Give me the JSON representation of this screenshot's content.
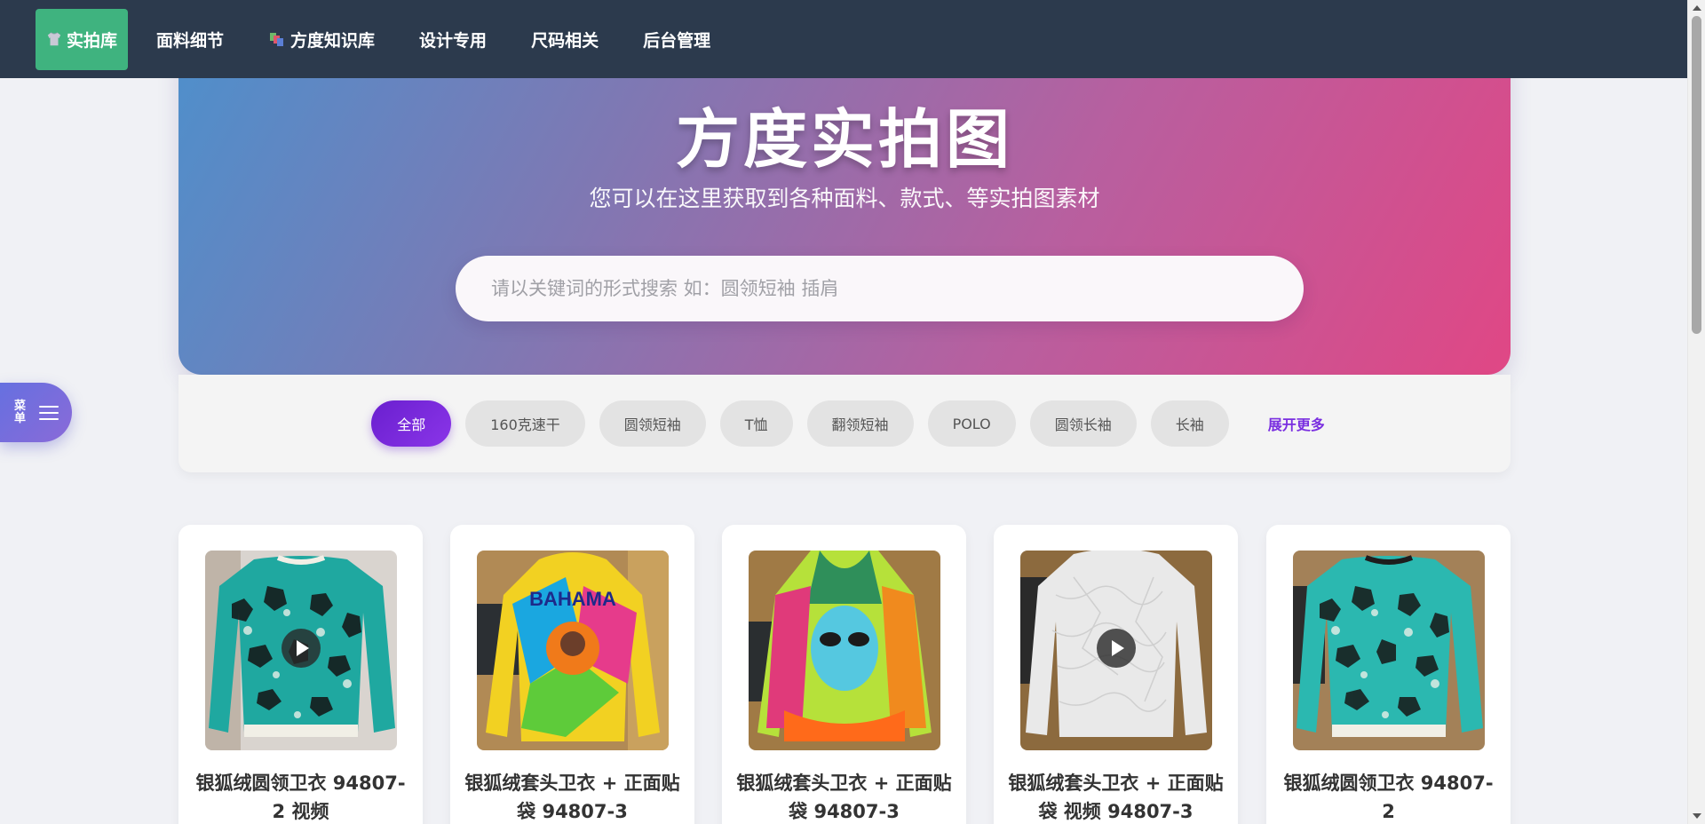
{
  "nav": {
    "items": [
      {
        "label": "实拍库",
        "icon": "shirt-icon",
        "active": true
      },
      {
        "label": "面料细节"
      },
      {
        "label": "方度知识库",
        "icon": "books-icon"
      },
      {
        "label": "设计专用"
      },
      {
        "label": "尺码相关"
      },
      {
        "label": "后台管理"
      }
    ]
  },
  "hero": {
    "title": "方度实拍图",
    "subtitle": "您可以在这里获取到各种面料、款式、等实拍图素材",
    "search_placeholder": "请以关键词的形式搜索 如：圆领短袖 插肩"
  },
  "filters": {
    "chips": [
      "全部",
      "160克速干",
      "圆领短袖",
      "T恤",
      "翻领短袖",
      "POLO",
      "圆领长袖",
      "长袖"
    ],
    "active_index": 0,
    "expand_label": "展开更多"
  },
  "side_menu": {
    "label": "菜单",
    "icon": "hamburger-icon"
  },
  "products": [
    {
      "title": "银狐绒圆领卫衣 94807-2 视频",
      "has_video": true,
      "image": "teal-black-pattern-sweatshirt"
    },
    {
      "title": "银狐绒套头卫衣 + 正面贴袋 94807-3",
      "has_video": false,
      "image": "colorful-graphic-hoodie"
    },
    {
      "title": "银狐绒套头卫衣 + 正面贴袋 94807-3",
      "has_video": false,
      "image": "neon-face-graphic-hoodie"
    },
    {
      "title": "银狐绒套头卫衣 + 正面贴袋 视频 94807-3",
      "has_video": true,
      "image": "white-textured-sweatshirt"
    },
    {
      "title": "银狐绒圆领卫衣 94807-2",
      "has_video": false,
      "image": "teal-black-pattern-sweatshirt"
    }
  ],
  "colors": {
    "nav_bg": "#2c3a4d",
    "nav_active": "#3fb37f",
    "hero_gradient_start": "#4f8fcb",
    "hero_gradient_end": "#e04785",
    "chip_active": "#7a2fe0"
  }
}
